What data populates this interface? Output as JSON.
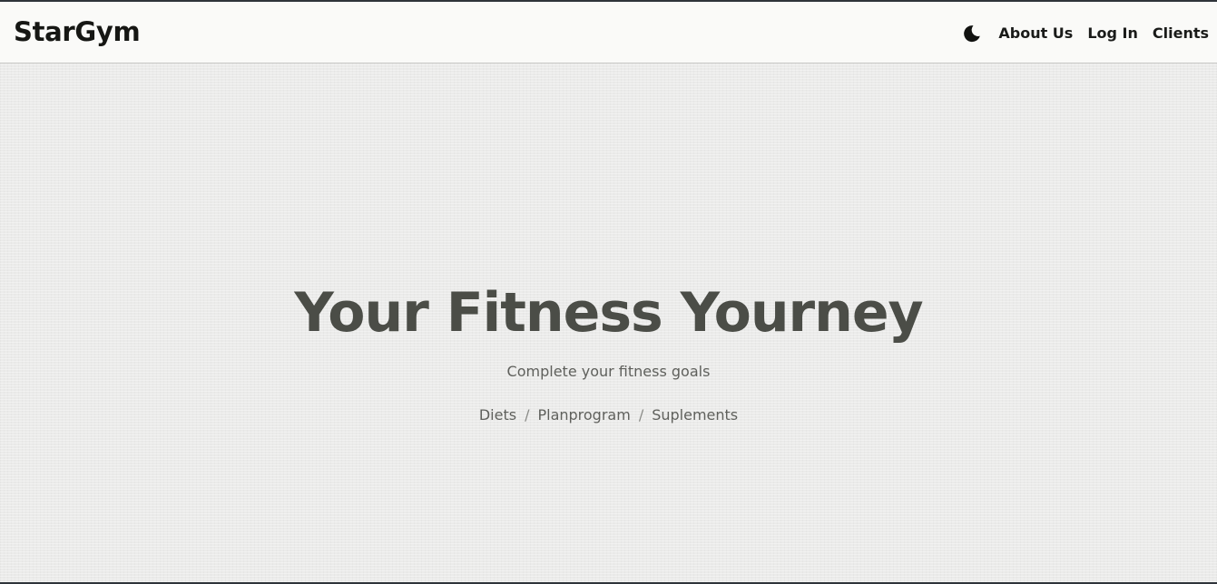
{
  "header": {
    "brand": "StarGym",
    "theme_toggle_icon": "moon-icon",
    "nav": [
      "About Us",
      "Log In",
      "Clients"
    ]
  },
  "hero": {
    "title": "Your Fitness Yourney",
    "subtitle": "Complete your fitness goals",
    "links": [
      "Diets",
      "Planprogram",
      "Suplements"
    ],
    "separator": "/"
  },
  "colors": {
    "navbar_bg": "#fafaf8",
    "hero_bg": "#ebebea",
    "title": "#4b4d47",
    "text": "#5f605c",
    "brand": "#161714"
  }
}
